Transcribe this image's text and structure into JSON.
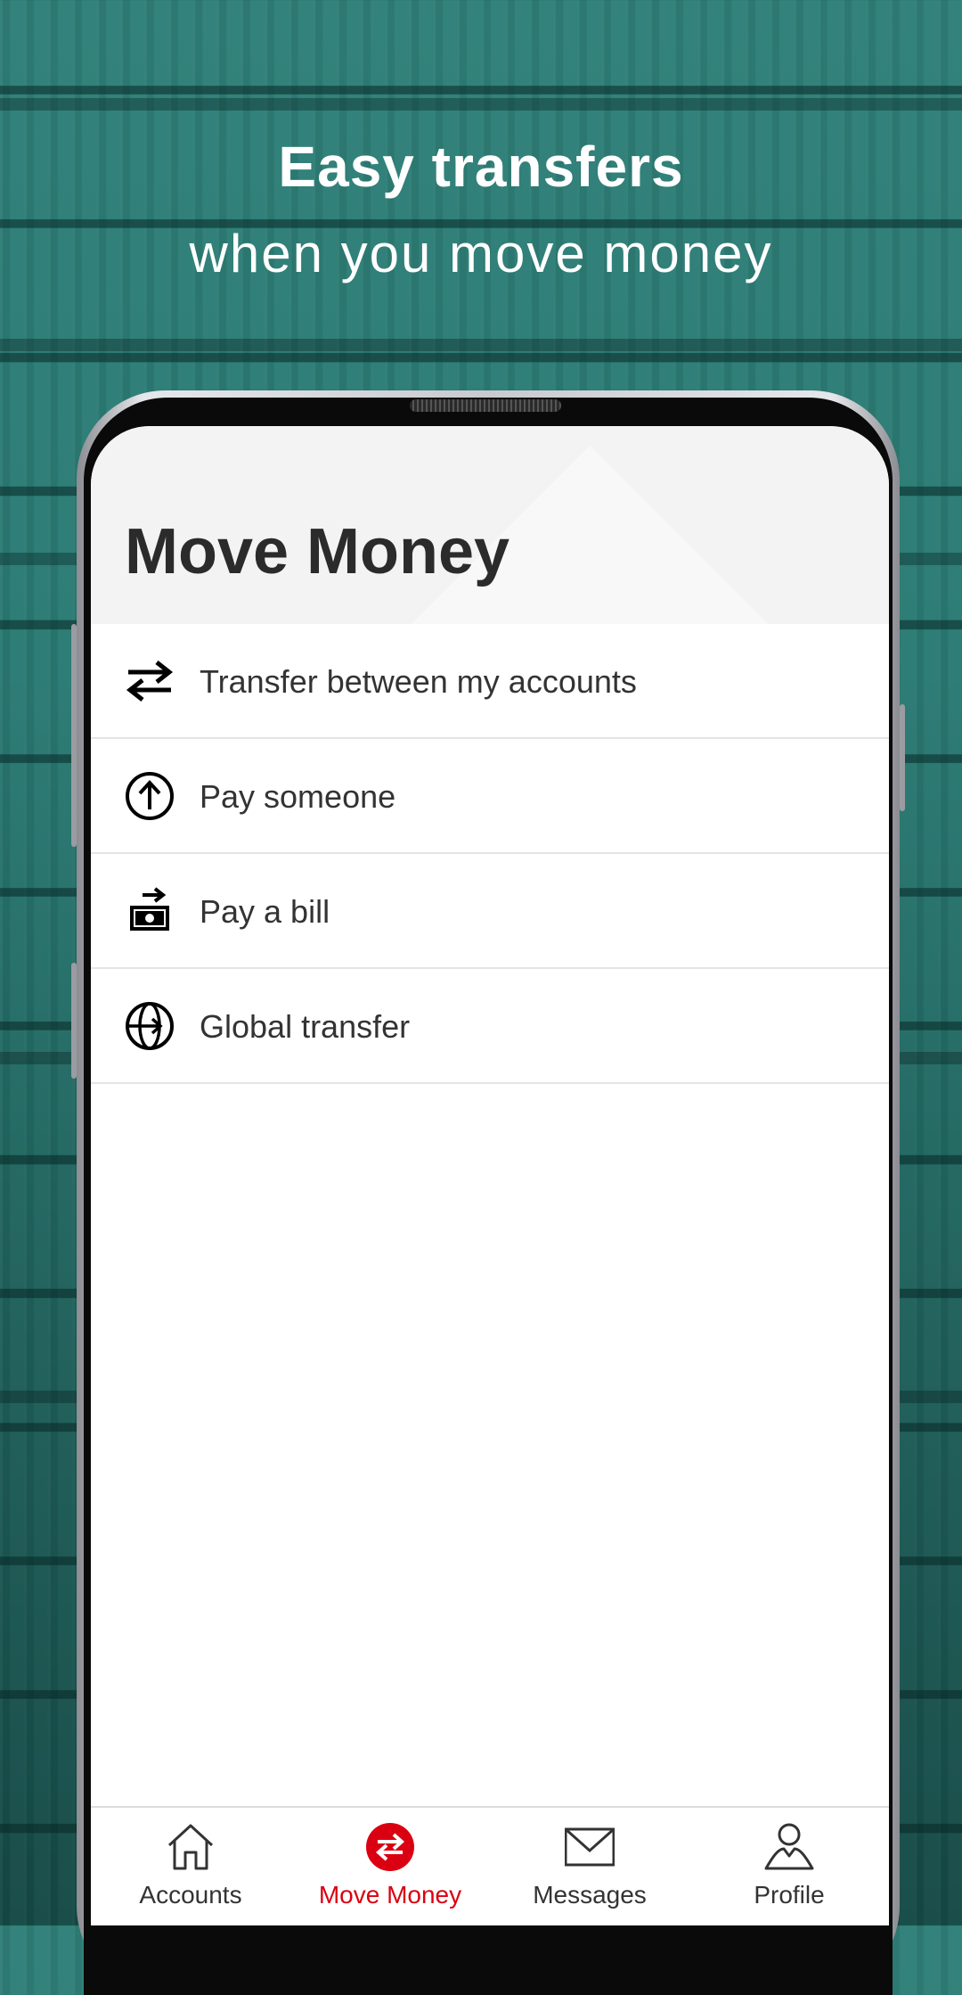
{
  "promo": {
    "title": "Easy transfers",
    "subtitle": "when you move money"
  },
  "screen": {
    "title": "Move Money"
  },
  "menu": {
    "items": [
      {
        "label": "Transfer between my accounts",
        "icon": "transfer-arrows-icon"
      },
      {
        "label": "Pay someone",
        "icon": "arrow-up-circle-icon"
      },
      {
        "label": "Pay a bill",
        "icon": "bill-payment-icon"
      },
      {
        "label": "Global transfer",
        "icon": "globe-transfer-icon"
      }
    ]
  },
  "tabs": [
    {
      "label": "Accounts",
      "icon": "home-icon",
      "active": false
    },
    {
      "label": "Move Money",
      "icon": "move-money-icon",
      "active": true
    },
    {
      "label": "Messages",
      "icon": "envelope-icon",
      "active": false
    },
    {
      "label": "Profile",
      "icon": "person-icon",
      "active": false
    }
  ],
  "colors": {
    "accent": "#db0011",
    "background_teal": "#2a7a73",
    "text": "#333333"
  }
}
